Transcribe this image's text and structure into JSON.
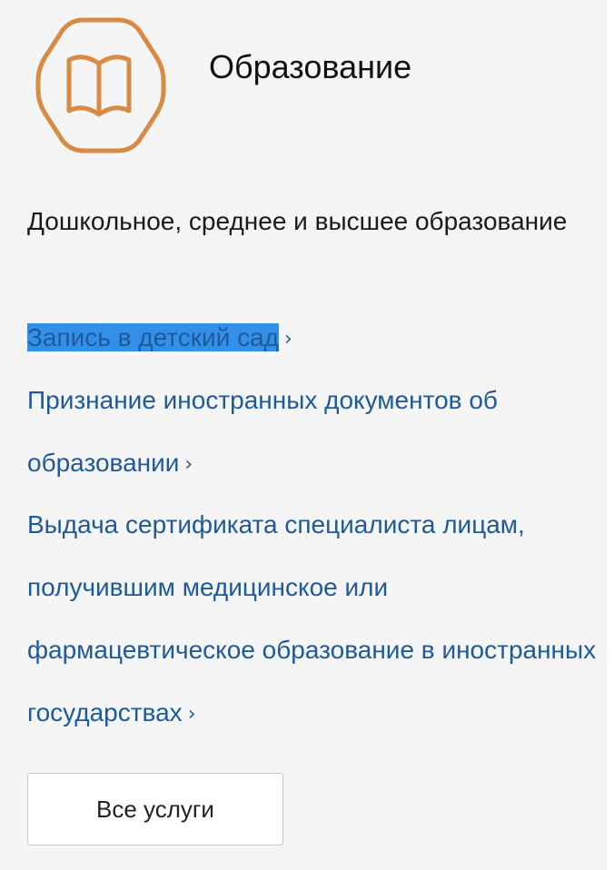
{
  "section": {
    "title": "Образование",
    "icon": "book-icon",
    "accent_color": "#d98a45",
    "subtitle": "Дошкольное, среднее и высшее образование"
  },
  "links": [
    {
      "label": "Запись в детский сад",
      "selected": true
    },
    {
      "label": "Признание иностранных документов об образовании"
    },
    {
      "label": "Выдача сертификата специалиста лицам, получившим медицинское или фармацевтическое образование в иностранных государствах"
    }
  ],
  "chevron": "›",
  "all_services_button": "Все услуги",
  "colors": {
    "link": "#1e5a9a",
    "selection": "#3390e8",
    "background": "#f5f5f5"
  }
}
